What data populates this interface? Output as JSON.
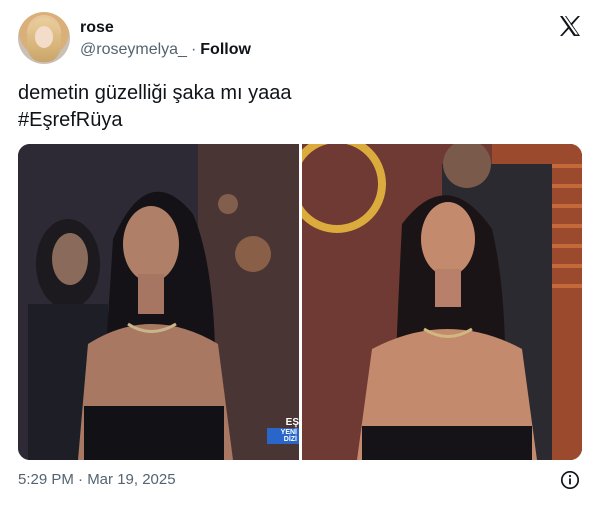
{
  "user": {
    "name": "rose",
    "handle": "@roseymelya_",
    "separator": "·",
    "follow_label": "Follow"
  },
  "platform": {
    "logo_icon": "x-logo-icon"
  },
  "tweet": {
    "lines": [
      "demetin güzelliği şaka mı yaaa",
      "#EşrefRüya"
    ],
    "timestamp": "5:29 PM · Mar 19, 2025"
  },
  "media": {
    "photos": [
      {
        "channel_logo_line1": "EŞ",
        "channel_logo_line2": "YENİ DİZİ"
      },
      {}
    ]
  },
  "icons": {
    "info": "info-icon"
  },
  "colors": {
    "text": "#0f1419",
    "secondary": "#536471",
    "background": "#ffffff"
  }
}
